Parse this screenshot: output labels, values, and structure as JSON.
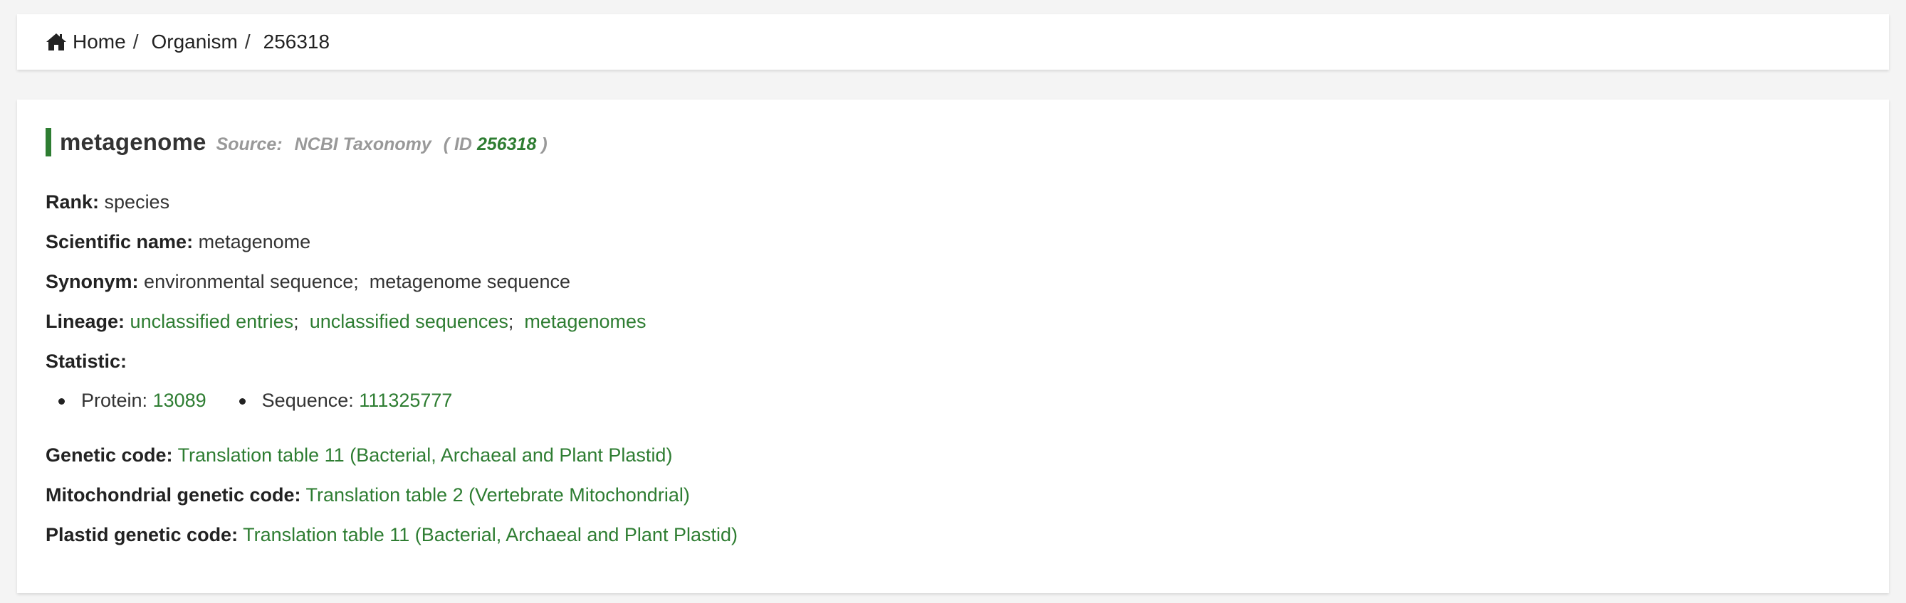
{
  "breadcrumb": {
    "items": [
      {
        "label": "Home",
        "icon": "home-icon"
      },
      {
        "label": "Organism"
      },
      {
        "label": "256318"
      }
    ],
    "separator": "/"
  },
  "organism": {
    "title": "metagenome",
    "source_label": "Source:",
    "source_name": "NCBI Taxonomy",
    "id_prefix": "( ID",
    "id_value": "256318",
    "id_suffix": ")"
  },
  "fields": {
    "rank": {
      "label": "Rank:",
      "value": "species"
    },
    "scientific_name": {
      "label": "Scientific name:",
      "value": "metagenome"
    },
    "synonym": {
      "label": "Synonym:",
      "values": [
        "environmental sequence",
        "metagenome sequence"
      ]
    },
    "lineage": {
      "label": "Lineage:",
      "links": [
        "unclassified entries",
        "unclassified sequences",
        "metagenomes"
      ]
    },
    "statistic": {
      "label": "Statistic:"
    },
    "genetic_code": {
      "label": "Genetic code:",
      "link": "Translation table 11 (Bacterial, Archaeal and Plant Plastid)"
    },
    "mito_code": {
      "label": "Mitochondrial genetic code:",
      "link": "Translation table 2 (Vertebrate Mitochondrial)"
    },
    "plastid_code": {
      "label": "Plastid genetic code:",
      "link": "Translation table 11 (Bacterial, Archaeal and Plant Plastid)"
    }
  },
  "statistics": [
    {
      "label": "Protein:",
      "value": "13089"
    },
    {
      "label": "Sequence:",
      "value": "111325777"
    }
  ],
  "colors": {
    "accent": "#2e7d32",
    "muted": "#999999",
    "background": "#f4f4f4"
  }
}
